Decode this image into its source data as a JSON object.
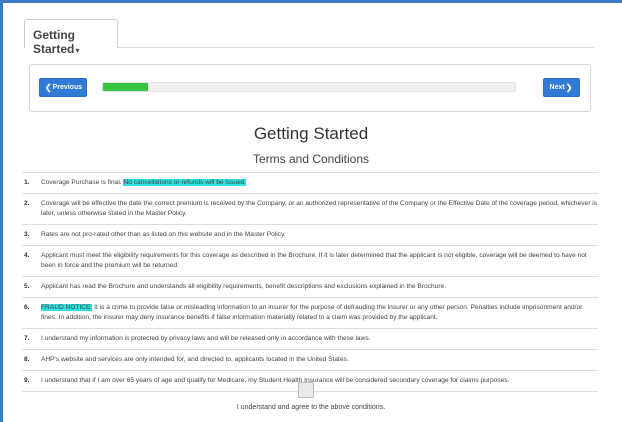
{
  "tab": {
    "label": "Getting Started",
    "caret": "▾"
  },
  "nav": {
    "previous_icon": "❮",
    "previous_label": "Previous",
    "next_label": "Next",
    "next_icon": "❯",
    "progress_fraction": 0.11,
    "progress_color": "#35c43f",
    "button_color": "#2f7bd5"
  },
  "page": {
    "title": "Getting Started",
    "subtitle": "Terms and Conditions"
  },
  "terms": [
    {
      "num": "1.",
      "text": "Coverage Purchase is final. ",
      "highlight": "No cancellations or refunds will be issued.",
      "rest": ""
    },
    {
      "num": "2.",
      "text": "Coverage will be effective the date the correct premium is received by the Company, or an authorized representative of the Company or the Effective Date of the coverage period, whichever is later, unless otherwise stated in the Master Policy.",
      "highlight": "",
      "rest": ""
    },
    {
      "num": "3.",
      "text": "Rates are not pro-rated other than as listed on this website and in the Master Policy.",
      "highlight": "",
      "rest": ""
    },
    {
      "num": "4.",
      "text": "Applicant must meet the eligibility requirements for this coverage as described in the Brochure. If it is later determined that the applicant is not eligible, coverage will be deemed to have not been in force and the premium will be returned.",
      "highlight": "",
      "rest": ""
    },
    {
      "num": "5.",
      "text": "Applicant has read the Brochure and understands all eligibility requirements, benefit descriptions and exclusions explained in the Brochure.",
      "highlight": "",
      "rest": ""
    },
    {
      "num": "6.",
      "text": "",
      "highlight": "FRAUD NOTICE:",
      "rest": " It is a crime to provide false or misleading information to an insurer for the purpose of defrauding the insurer or any other person. Penalties include imprisonment and/or fines. In addition, the insurer may deny insurance benefits if false information materially related to a claim was provided by the applicant."
    },
    {
      "num": "7.",
      "text": "I understand my information is protected by privacy laws and will be released only in accordance with these laws.",
      "highlight": "",
      "rest": ""
    },
    {
      "num": "8.",
      "text": "AHP's website and services are only intended for, and directed to, applicants located in the United States.",
      "highlight": "",
      "rest": ""
    },
    {
      "num": "9.",
      "text": "I understand that if I am over 65 years of age and qualify for Medicare, my Student Health Insurance will be considered secondary coverage for claims purposes.",
      "highlight": "",
      "rest": ""
    }
  ],
  "agreement": {
    "label": "I understand and agree to the above conditions.",
    "checked": false
  },
  "colors": {
    "highlight": "#2fe0e0",
    "frame_accent": "#3b7dc4"
  }
}
